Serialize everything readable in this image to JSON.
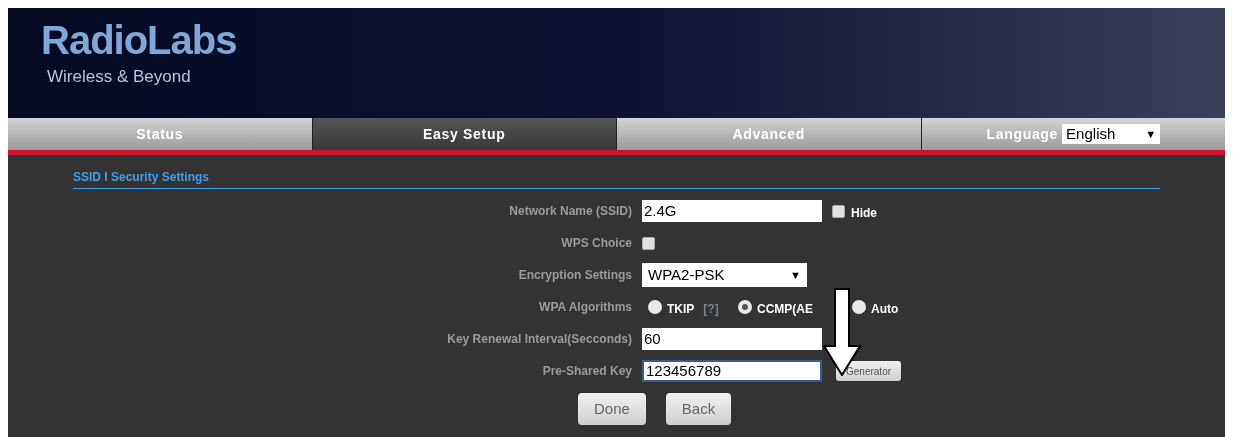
{
  "header": {
    "logo": "RadioLabs",
    "tagline": "Wireless & Beyond"
  },
  "tabs": [
    {
      "label": "Status",
      "selected": false
    },
    {
      "label": "Easy Setup",
      "selected": true
    },
    {
      "label": "Advanced",
      "selected": false
    }
  ],
  "language": {
    "label": "Language",
    "value": "English",
    "caret": "▼"
  },
  "section_title": "SSID I Security Settings",
  "form": [
    {
      "kind": "text",
      "label": "Network Name (SSID)",
      "value": "2.4G",
      "checkbox": {
        "label": "Hide",
        "checked": false
      }
    },
    {
      "kind": "checkbox",
      "label": "WPS Choice",
      "checked": false
    },
    {
      "kind": "select",
      "label": "Encryption Settings",
      "value": "WPA2-PSK",
      "caret": "▼"
    },
    {
      "kind": "radio",
      "label": "WPA Algorithms",
      "options": [
        {
          "label": "TKIP",
          "selected": false,
          "help": "[?]"
        },
        {
          "label": "CCMP(AE",
          "selected": true
        },
        {
          "label": "Auto",
          "selected": false
        }
      ]
    },
    {
      "kind": "text",
      "label": "Key Renewal Interval(Secconds)",
      "value": "60"
    },
    {
      "kind": "text",
      "label": "Pre-Shared Key",
      "value": "123456789",
      "focused": true,
      "button": "Generator"
    }
  ],
  "buttons": [
    "Done",
    "Back"
  ]
}
